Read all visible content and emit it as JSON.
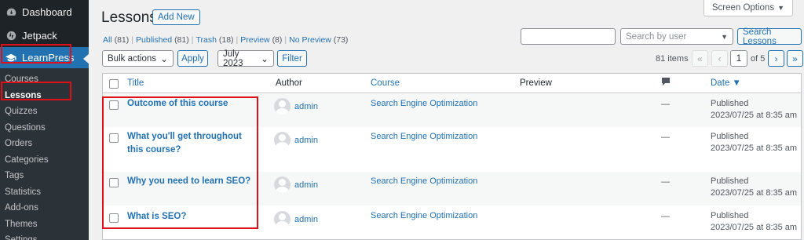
{
  "sidebar": {
    "top_items": [
      {
        "label": "Dashboard",
        "icon": "dashboard-icon"
      },
      {
        "label": "Jetpack",
        "icon": "jetpack-icon"
      },
      {
        "label": "LearnPress",
        "icon": "graduation-cap-icon"
      }
    ],
    "sub_items": [
      "Courses",
      "Lessons",
      "Quizzes",
      "Questions",
      "Orders",
      "Categories",
      "Tags",
      "Statistics",
      "Add-ons",
      "Themes",
      "Settings"
    ]
  },
  "header": {
    "title": "Lessons",
    "add_new": "Add New",
    "screen_options": "Screen Options"
  },
  "filters": {
    "views": [
      {
        "label": "All",
        "count": "(81)"
      },
      {
        "label": "Published",
        "count": "(81)"
      },
      {
        "label": "Trash",
        "count": "(18)"
      },
      {
        "label": "Preview",
        "count": "(8)"
      },
      {
        "label": "No Preview",
        "count": "(73)"
      }
    ],
    "search_value": "",
    "search_by_user_placeholder": "Search by user",
    "search_button": "Search Lessons",
    "bulk_actions": "Bulk actions",
    "apply": "Apply",
    "date_filter": "July 2023",
    "filter_button": "Filter"
  },
  "pagination": {
    "items": "81 items",
    "first": "«",
    "prev": "‹",
    "current_page": "1",
    "of_pages": "of 5",
    "next": "›",
    "last": "»"
  },
  "table": {
    "columns": {
      "title": "Title",
      "author": "Author",
      "course": "Course",
      "preview": "Preview",
      "comments_icon": "comment-icon",
      "date": "Date ▼"
    },
    "rows": [
      {
        "title": "Outcome of this course",
        "author": "admin",
        "course": "Search Engine Optimization",
        "preview": "—",
        "status": "Published",
        "date": "2023/07/25 at 8:35 am"
      },
      {
        "title": "What you'll get throughout this course?",
        "author": "admin",
        "course": "Search Engine Optimization",
        "preview": "—",
        "status": "Published",
        "date": "2023/07/25 at 8:35 am"
      },
      {
        "title": "Why you need to learn SEO?",
        "author": "admin",
        "course": "Search Engine Optimization",
        "preview": "—",
        "status": "Published",
        "date": "2023/07/25 at 8:35 am"
      },
      {
        "title": "What is SEO?",
        "author": "admin",
        "course": "Search Engine Optimization",
        "preview": "—",
        "status": "Published",
        "date": "2023/07/25 at 8:35 am"
      }
    ]
  },
  "colors": {
    "sidebar_bg": "#1d2327",
    "accent": "#2271b1",
    "highlight_border": "#e0101a"
  }
}
